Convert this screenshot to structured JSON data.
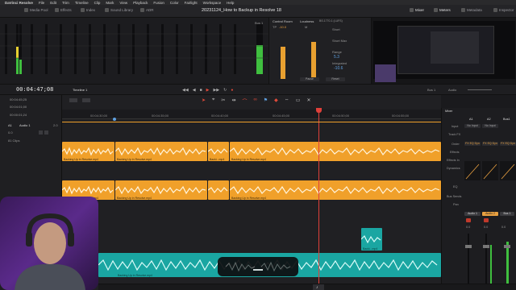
{
  "menubar": {
    "app": "DaVinci Resolve",
    "items": [
      "File",
      "Edit",
      "Trim",
      "Timeline",
      "Clip",
      "Mark",
      "View",
      "Playback",
      "Fusion",
      "Color",
      "Fairlight",
      "Workspace",
      "Help"
    ]
  },
  "toolbar": {
    "left_tabs": [
      "Media Pool",
      "Effects",
      "Index",
      "Sound Library",
      "ADR"
    ],
    "project_title": "20231124_How to Backup in Resolve 18",
    "right_tabs": [
      "Mixer",
      "Meters",
      "Metadata",
      "Inspector"
    ]
  },
  "meters": {
    "bus_label": "Bus 1"
  },
  "control_room": {
    "title": "Control Room",
    "loudness": "Loudness",
    "tp_label": "TP",
    "tp_value": "-10.0",
    "m_label": "M",
    "short_label": "Short",
    "short_max_label": "Short Max",
    "range_label": "Range",
    "range_value": "5.3",
    "integrated_label": "Integrated",
    "integrated_value": "-10.6",
    "pause_btn": "Pause",
    "reset_btn": "Reset",
    "standard": "BS.1770-1 (LUFS)"
  },
  "timecode_row": {
    "timecode": "00:04:47;08",
    "timeline_name": "Timeline 1",
    "bus_label": "Bus 1",
    "audio_label": "Audio"
  },
  "track_headers": {
    "tc_rows": [
      "00:04:45;25",
      "00:04:01;00",
      "00:00:01;24"
    ],
    "track_name_id": "A1",
    "track_name": "Audio 1",
    "track_format": "2.0",
    "track_level": "0.0",
    "clips_label": "81 Clips"
  },
  "ruler": {
    "labels": [
      "00:04:30;00",
      "00:04:35;00",
      "00:04:40;00",
      "00:04:45;00",
      "00:04:50;00",
      "00:04:55;00"
    ]
  },
  "clips": {
    "orange_label": "Backing Up in Resolve.mp4",
    "teal_label": "Backing Up in Resolve.mp4",
    "small_teal_label": "Backi...mp4"
  },
  "mixer": {
    "title": "Mixer",
    "columns": [
      "A1",
      "A2",
      "Bus1"
    ],
    "input_label": "Input",
    "input_values": [
      "No Input",
      "No Input"
    ],
    "track_fx_label": "Track FX",
    "order_label": "Order",
    "order_values": [
      "FX EQ Dyn",
      "FX EQ Dyn",
      "FX EQ Dyn"
    ],
    "effects_label": "Effects",
    "effects_in_label": "Effects In",
    "dynamics_label": "Dynamics",
    "eq_label": "EQ",
    "bus_sends_label": "Bus Sends",
    "pan_label": "Pan",
    "channel_names": [
      "Audio 1",
      "Audio 2",
      "Bus 1"
    ],
    "meter_values": [
      "0.0",
      "0.0",
      "0.0"
    ]
  },
  "colors": {
    "orange_clip": "#f0a02a",
    "teal_clip": "#1aa6a2",
    "playhead": "#e0403a",
    "meter_green": "#3fbf3f",
    "meter_yellow": "#e8d030"
  }
}
